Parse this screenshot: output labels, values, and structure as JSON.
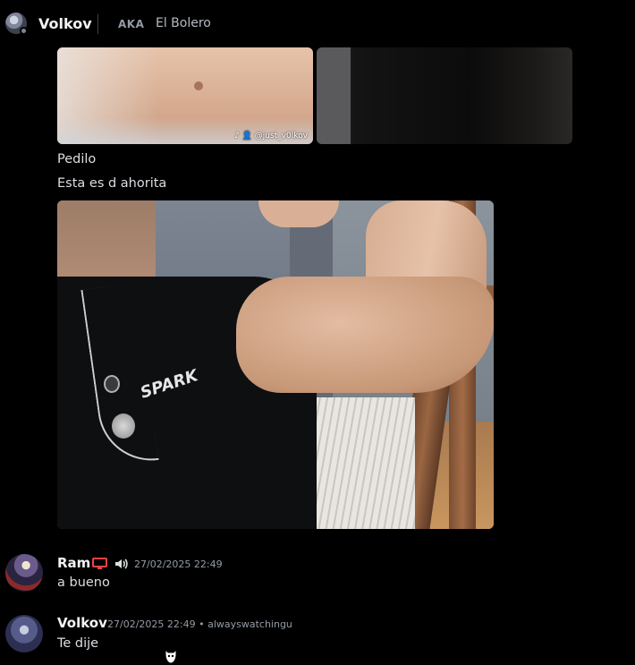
{
  "header": {
    "name": "Volkov",
    "aka_label": "AKA",
    "alias": "El Bolero"
  },
  "attachments": {
    "image1_watermark": "♪ 👤 @just_v0lkov"
  },
  "messages_text": {
    "line1": "Pedilo",
    "line2": "Esta es d ahorita"
  },
  "image3_logo": "SPARK",
  "messages": [
    {
      "username": "Ram",
      "timestamp": "27/02/2025 22:49",
      "content": "a bueno",
      "badges": [
        "monitor-icon",
        "speaker-icon"
      ],
      "accent_color": "#ed4245"
    },
    {
      "username": "Volkov",
      "timestamp": "27/02/2025 22:49 • alwayswatchingu",
      "content": "Te dije"
    }
  ],
  "colors": {
    "background": "#000000",
    "text": "#dbdee1",
    "username": "#f2f3f5",
    "muted": "#949ba4"
  }
}
